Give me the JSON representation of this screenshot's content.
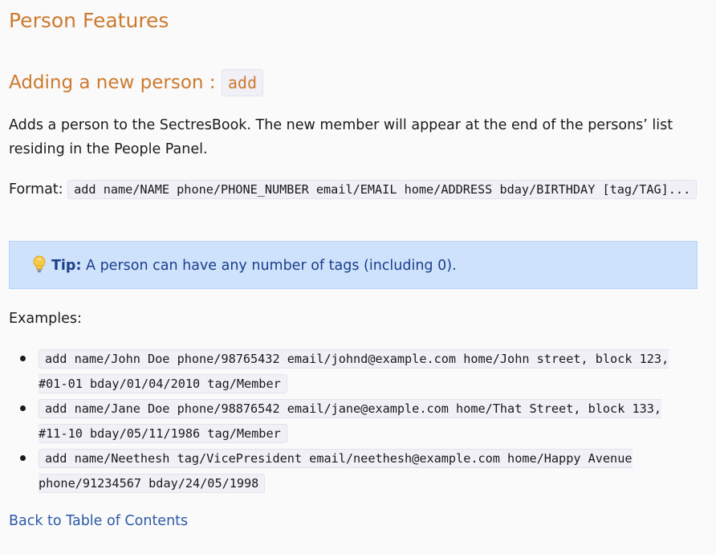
{
  "page": {
    "title": "Person Features",
    "section_heading": "Adding a new person : ",
    "section_command": "add",
    "description": "Adds a person to the SectresBook. The new member will appear at the end of the persons’ list residing in the People Panel.",
    "format_label": "Format: ",
    "format_code": "add name/NAME phone/PHONE_NUMBER email/EMAIL home/ADDRESS bday/BIRTHDAY [tag/TAG]...",
    "tip": {
      "icon": "lightbulb-icon",
      "label": "Tip:",
      "text": " A person can have any number of tags (including 0)."
    },
    "examples_label": "Examples:",
    "examples": [
      "add name/John Doe phone/98765432 email/johnd@example.com home/John street, block 123, #01-01 bday/01/04/2010 tag/Member",
      "add name/Jane Doe phone/98876542 email/jane@example.com home/That Street, block 133, #11-10 bday/05/11/1986 tag/Member",
      "add name/Neethesh tag/VicePresident email/neethesh@example.com home/Happy Avenue phone/91234567 bday/24/05/1998"
    ],
    "back_link": "Back to Table of Contents"
  },
  "colors": {
    "heading": "#cc7a2f",
    "link": "#2c5aa8",
    "tip_background": "#cfe2fc",
    "tip_text": "#1a3f8a",
    "code_background": "#f0f0f6"
  }
}
